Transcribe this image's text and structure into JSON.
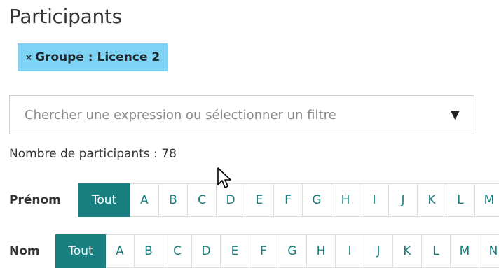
{
  "header": {
    "title": "Participants"
  },
  "active_filter": {
    "remove_glyph": "×",
    "label": "Groupe : Licence 2"
  },
  "search": {
    "placeholder": "Chercher une expression ou sélectionner un filtre",
    "value": "",
    "dropdown_glyph": "▼"
  },
  "summary": {
    "count_text": "Nombre de participants : 78"
  },
  "initials_filters": {
    "prenom": {
      "label": "Prénom",
      "items": [
        "Tout",
        "A",
        "B",
        "C",
        "D",
        "E",
        "F",
        "G",
        "H",
        "I",
        "J",
        "K",
        "L",
        "M"
      ],
      "selected": "Tout"
    },
    "nom": {
      "label": "Nom",
      "items": [
        "Tout",
        "A",
        "B",
        "C",
        "D",
        "E",
        "F",
        "G",
        "H",
        "I",
        "J",
        "K",
        "L",
        "M",
        "N"
      ],
      "selected": "Tout"
    }
  },
  "colors": {
    "accent": "#1a7f80",
    "chip_background": "#7fd3f5"
  },
  "icons": {
    "filter_remove": "close-icon",
    "search_dropdown": "caret-down-icon",
    "mouse_cursor": "arrow-cursor-icon"
  }
}
